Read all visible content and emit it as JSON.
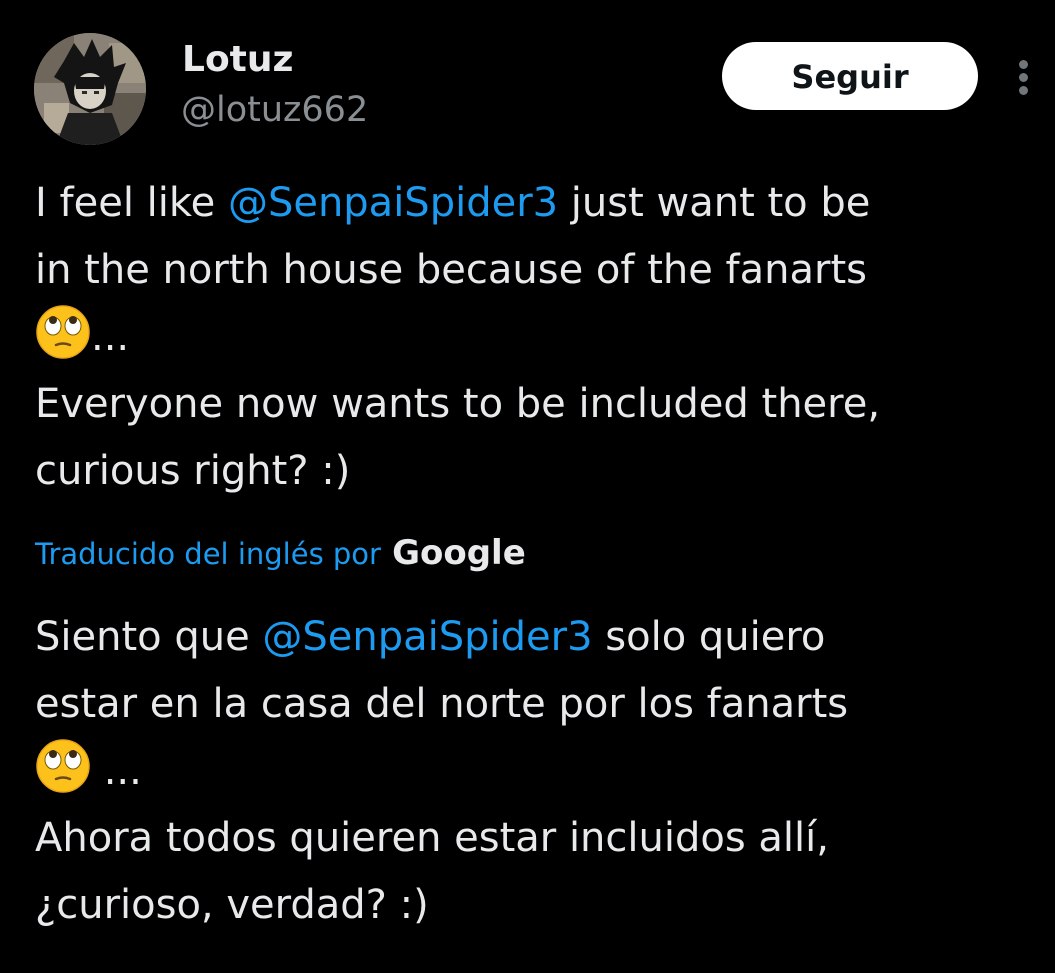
{
  "author": {
    "display_name": "Lotuz",
    "handle": "@lotuz662"
  },
  "actions": {
    "follow_label": "Seguir",
    "more_icon": "more-vertical-icon"
  },
  "tweet": {
    "line1_pre": "I feel like ",
    "line1_mention": "@SenpaiSpider3",
    "line1_post": " just want to be",
    "line2": "in the north house because of the fanarts",
    "line3_emoji": "face-with-rolling-eyes-emoji",
    "line3_text": "...",
    "line4": "Everyone now wants to be included there,",
    "line5": "curious right? :)"
  },
  "translation": {
    "label": "Traducido del inglés por",
    "provider": "Google",
    "line1_pre": "Siento que ",
    "line1_mention": "@SenpaiSpider3",
    "line1_post": " solo quiero",
    "line2": "estar en la casa del norte por los fanarts",
    "line3_emoji": "face-with-rolling-eyes-emoji",
    "line3_text": " ...",
    "line4": "Ahora todos quieren estar incluidos allí,",
    "line5": "¿curioso, verdad? :)"
  },
  "colors": {
    "background": "#000000",
    "text": "#e7e9ea",
    "secondary": "#8a8f94",
    "link": "#1d9bf0",
    "button_bg": "#ffffff",
    "button_text": "#0f1419"
  }
}
